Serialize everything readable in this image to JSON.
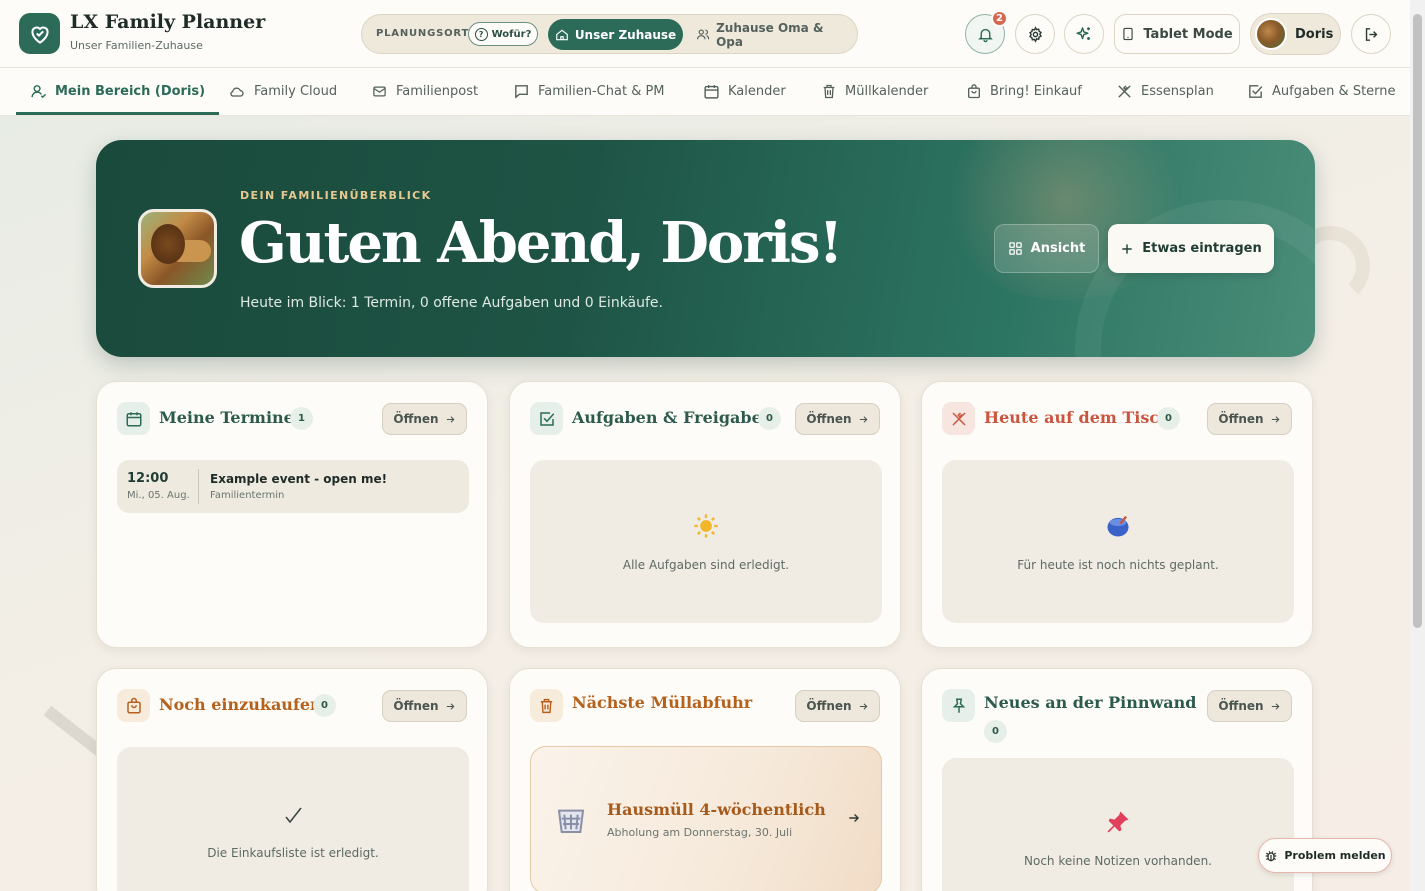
{
  "app": {
    "title": "LX Family Planner",
    "subtitle": "Unser Familien-Zuhause"
  },
  "planung": {
    "label": "PLANUNGSORT",
    "help": "Wofür?",
    "active": "Unser Zuhause",
    "other": "Zuhause Oma & Opa"
  },
  "header": {
    "notifications": "2",
    "tablet_mode": "Tablet Mode",
    "user": "Doris"
  },
  "tabs": [
    {
      "label": "Mein Bereich (Doris)",
      "icon": "user-icon"
    },
    {
      "label": "Family Cloud",
      "icon": "cloud-icon"
    },
    {
      "label": "Familienpost",
      "icon": "mail-icon"
    },
    {
      "label": "Familien-Chat & PM",
      "icon": "chat-icon"
    },
    {
      "label": "Kalender",
      "icon": "calendar-icon"
    },
    {
      "label": "Müllkalender",
      "icon": "trash-icon"
    },
    {
      "label": "Bring! Einkauf",
      "icon": "bag-icon"
    },
    {
      "label": "Essensplan",
      "icon": "cutlery-icon"
    },
    {
      "label": "Aufgaben & Sterne",
      "icon": "checkbox-icon"
    }
  ],
  "hero": {
    "eyebrow": "DEIN FAMILIENÜBERBLICK",
    "greeting": "Guten Abend, Doris!",
    "summary": "Heute im Blick: 1 Termin, 0 offene Aufgaben und 0 Einkäufe.",
    "view_button": "Ansicht",
    "add_button": "Etwas eintragen"
  },
  "cards": {
    "open_label": "Öffnen",
    "termine": {
      "title": "Meine Termine",
      "count": "1",
      "event": {
        "time": "12:00",
        "date": "Mi., 05. Aug.",
        "title": "Example event - open me!",
        "type": "Familientermin"
      }
    },
    "aufgaben": {
      "title": "Aufgaben & Freigaben",
      "count": "0",
      "empty": "Alle Aufgaben sind erledigt."
    },
    "tisch": {
      "title": "Heute auf dem Tisch",
      "count": "0",
      "empty": "Für heute ist noch nichts geplant."
    },
    "einkauf": {
      "title": "Noch einzukaufen",
      "count": "0",
      "empty": "Die Einkaufsliste ist erledigt."
    },
    "muell": {
      "title": "Nächste Müllabfuhr",
      "item_title": "Hausmüll 4-wöchentlich",
      "item_sub": "Abholung am Donnerstag, 30. Juli"
    },
    "pinnwand": {
      "title": "Neues an der Pinnwand",
      "count": "0",
      "empty": "Noch keine Notizen vorhanden."
    }
  },
  "report": "Problem melden",
  "colors": {
    "brand": "#2c6b58",
    "accent_red": "#c9553f",
    "accent_orange": "#a65a1b",
    "badge": "#d4674f"
  }
}
